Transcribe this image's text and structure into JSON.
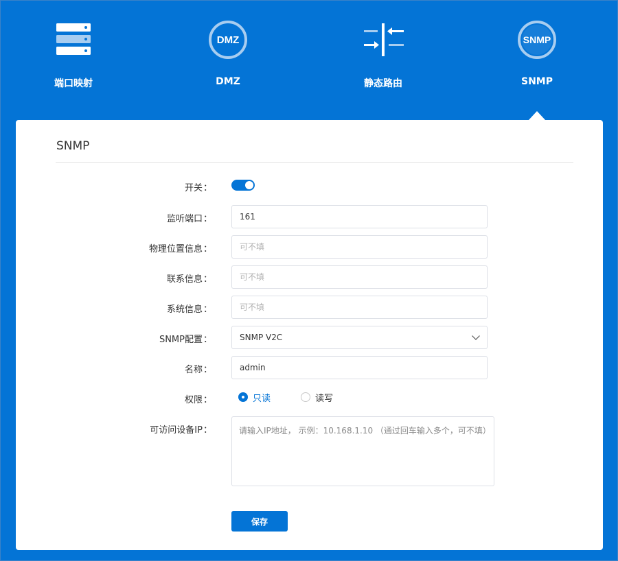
{
  "nav": {
    "items": [
      {
        "label": "端口映射",
        "icon": "server-icon"
      },
      {
        "label": "DMZ",
        "icon": "dmz-icon"
      },
      {
        "label": "静态路由",
        "icon": "static-route-icon"
      },
      {
        "label": "SNMP",
        "icon": "snmp-icon",
        "active": true
      }
    ],
    "icon_texts": {
      "dmz": "DMZ",
      "snmp": "SNMP"
    }
  },
  "colors": {
    "accent": "#0474d6",
    "card": "#ffffff"
  },
  "form": {
    "title": "SNMP",
    "switch": {
      "label": "开关",
      "on": true
    },
    "port": {
      "label": "监听端口",
      "value": "161"
    },
    "location": {
      "label": "物理位置信息",
      "placeholder": "可不填"
    },
    "contact": {
      "label": "联系信息",
      "placeholder": "可不填"
    },
    "system": {
      "label": "系统信息",
      "placeholder": "可不填"
    },
    "config": {
      "label": "SNMP配置",
      "value": "SNMP V2C"
    },
    "name": {
      "label": "名称",
      "value": "admin"
    },
    "permission": {
      "label": "权限",
      "options": [
        {
          "label": "只读",
          "checked": true
        },
        {
          "label": "读写",
          "checked": false
        }
      ]
    },
    "allowed_ip": {
      "label": "可访问设备IP",
      "placeholder": "请输入IP地址， 示例：10.168.1.10 （通过回车输入多个，可不填）"
    },
    "colon": "：",
    "save_label": "保存"
  }
}
